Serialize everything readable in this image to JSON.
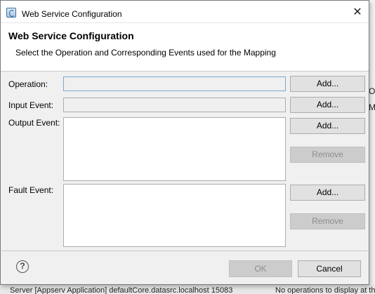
{
  "window": {
    "title": "Web Service Configuration",
    "close_glyph": "✕"
  },
  "header": {
    "title": "Web Service Configuration",
    "description": "Select the Operation and Corresponding Events used for the Mapping"
  },
  "form": {
    "operation_label": "Operation:",
    "input_event_label": "Input Event:",
    "output_event_label": "Output Event:",
    "fault_event_label": "Fault Event:",
    "add_label": "Add...",
    "remove_label": "Remove"
  },
  "footer": {
    "help_glyph": "?",
    "ok_label": "OK",
    "cancel_label": "Cancel"
  },
  "background": {
    "right_fragment_1": "Ou",
    "right_fragment_2": "My",
    "bottom_text": "Server [Appserv Application] defaultCore.datasrc.localhost 15083",
    "bottom_right_text": "No operations to display at this time"
  }
}
